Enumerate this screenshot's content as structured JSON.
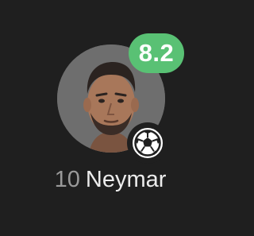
{
  "player": {
    "shirt_number": "10",
    "name": "Neymar",
    "rating": "8.2",
    "event_icon": "football-icon"
  },
  "colors": {
    "background": "#1f1f1f",
    "rating_badge": "#59c174",
    "avatar_ring": "#6e6e6e",
    "name_text": "#ececec",
    "number_text": "#9a9a9a"
  }
}
